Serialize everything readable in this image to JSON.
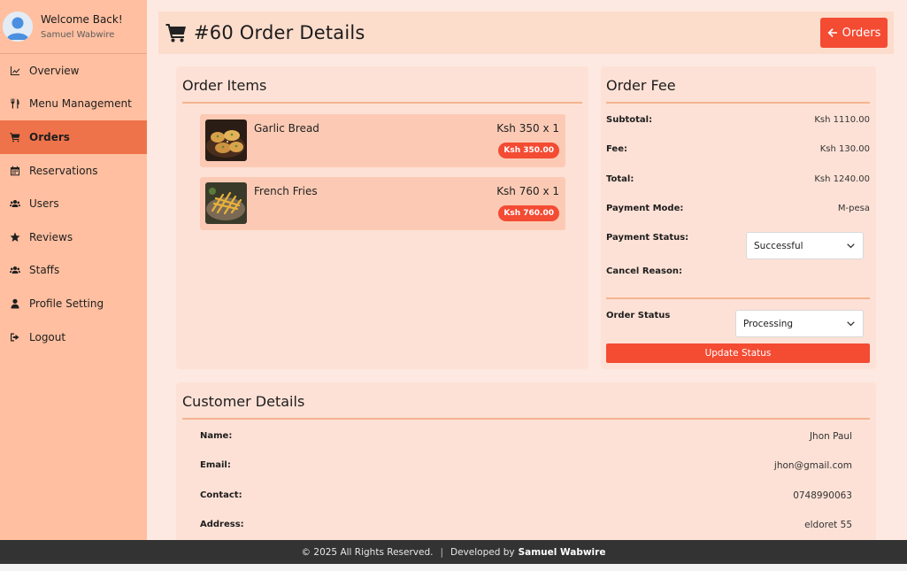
{
  "sidebar": {
    "welcome": "Welcome Back!",
    "username": "Samuel Wabwire",
    "items": [
      {
        "label": "Overview",
        "icon": "chart-line-icon"
      },
      {
        "label": "Menu Management",
        "icon": "utensils-icon"
      },
      {
        "label": "Orders",
        "icon": "cart-icon",
        "active": true
      },
      {
        "label": "Reservations",
        "icon": "calendar-icon"
      },
      {
        "label": "Users",
        "icon": "users-icon"
      },
      {
        "label": "Reviews",
        "icon": "star-icon"
      },
      {
        "label": "Staffs",
        "icon": "users-icon"
      },
      {
        "label": "Profile Setting",
        "icon": "user-icon"
      },
      {
        "label": "Logout",
        "icon": "sign-out-icon"
      }
    ]
  },
  "header": {
    "title": "#60 Order Details",
    "orders_button": "Orders"
  },
  "order_items": {
    "title": "Order Items",
    "items": [
      {
        "name": "Garlic Bread",
        "qty": "Ksh 350 x 1",
        "total": "Ksh 350.00"
      },
      {
        "name": "French Fries",
        "qty": "Ksh 760 x 1",
        "total": "Ksh 760.00"
      }
    ]
  },
  "order_fee": {
    "title": "Order Fee",
    "subtotal_label": "Subtotal:",
    "subtotal": "Ksh 1110.00",
    "fee_label": "Fee:",
    "fee": "Ksh 130.00",
    "total_label": "Total:",
    "total": "Ksh 1240.00",
    "payment_mode_label": "Payment Mode:",
    "payment_mode": "M-pesa",
    "payment_status_label": "Payment Status:",
    "payment_status": "Successful",
    "cancel_reason_label": "Cancel Reason:",
    "order_status_label": "Order Status",
    "order_status": "Processing",
    "update_button": "Update Status"
  },
  "customer": {
    "title": "Customer Details",
    "name_label": "Name:",
    "name": "Jhon Paul",
    "email_label": "Email:",
    "email": "jhon@gmail.com",
    "contact_label": "Contact:",
    "contact": "0748990063",
    "address_label": "Address:",
    "address": "eldoret 55"
  },
  "footer": {
    "copyright": "© 2025 All Rights Reserved.",
    "separator": "|",
    "developed_by": "Developed by",
    "developer": "Samuel Wabwire"
  },
  "colors": {
    "accent": "#f44b33",
    "sidebar_bg": "#ffbfa0",
    "sidebar_active": "#ef734a",
    "page_bg": "#fde9e2",
    "card_bg": "#fde1d6",
    "item_bg": "#fccab4",
    "footer_bg": "#333333"
  }
}
